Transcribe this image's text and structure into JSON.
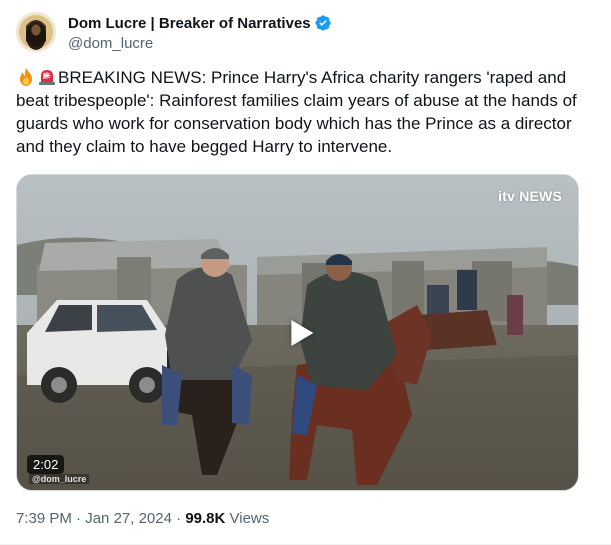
{
  "author": {
    "display_name": "Dom Lucre | Breaker of Narratives",
    "handle": "@dom_lucre",
    "verified": true,
    "verified_color": "#1d9bf0"
  },
  "tweet": {
    "emojis": [
      "fire",
      "police-light"
    ],
    "text": "BREAKING NEWS: Prince Harry's Africa charity rangers 'raped and beat tribespeople': Rainforest families claim years of abuse at the hands of guards who work for conservation body which has the Prince as a director and they claim to have begged Harry to intervene."
  },
  "media": {
    "watermark_brand": "itv NEWS",
    "duration": "2:02",
    "corner_watermark": "@dom_lucre"
  },
  "meta": {
    "time": "7:39 PM",
    "separator1": " · ",
    "date": "Jan 27, 2024",
    "separator2": " · ",
    "views_count": "99.8K",
    "views_label": " Views"
  }
}
